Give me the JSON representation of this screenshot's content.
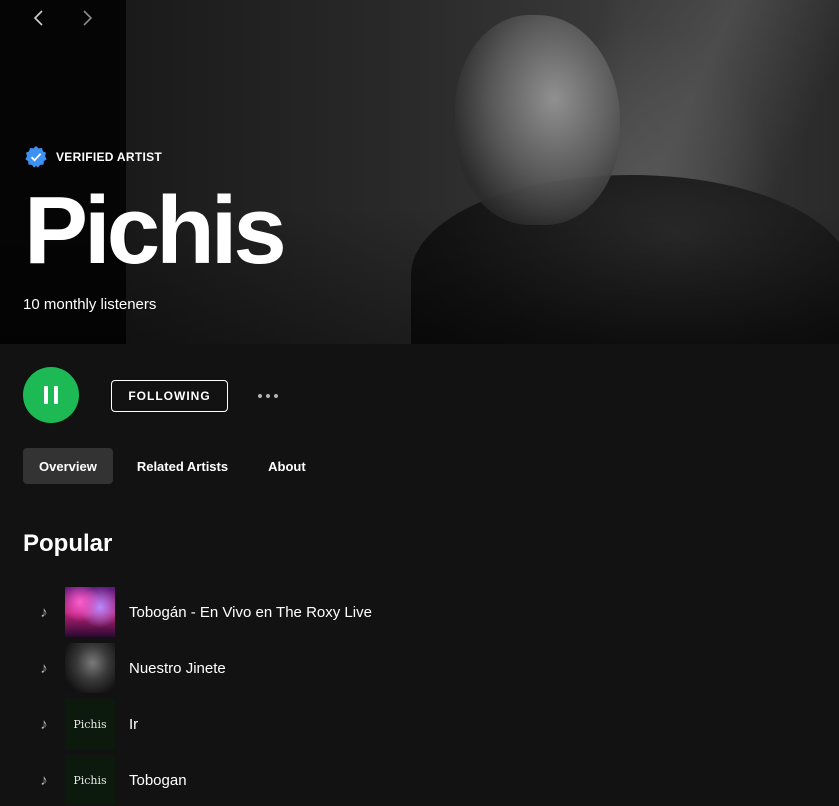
{
  "hero": {
    "verified_label": "VERIFIED ARTIST",
    "artist_name": "Pichis",
    "monthly_listeners": "10 monthly listeners"
  },
  "actions": {
    "follow_label": "FOLLOWING"
  },
  "tabs": [
    {
      "label": "Overview",
      "active": true
    },
    {
      "label": "Related Artists",
      "active": false
    },
    {
      "label": "About",
      "active": false
    }
  ],
  "popular": {
    "title": "Popular",
    "tracks": [
      {
        "title": "Tobogán - En Vivo en The Roxy Live",
        "thumb_text": ""
      },
      {
        "title": "Nuestro Jinete",
        "thumb_text": ""
      },
      {
        "title": "Ir",
        "thumb_text": "Pichis"
      },
      {
        "title": "Tobogan",
        "thumb_text": "Pichis"
      }
    ]
  },
  "colors": {
    "accent": "#1db954",
    "verified": "#3d91f4",
    "background": "#121212"
  }
}
